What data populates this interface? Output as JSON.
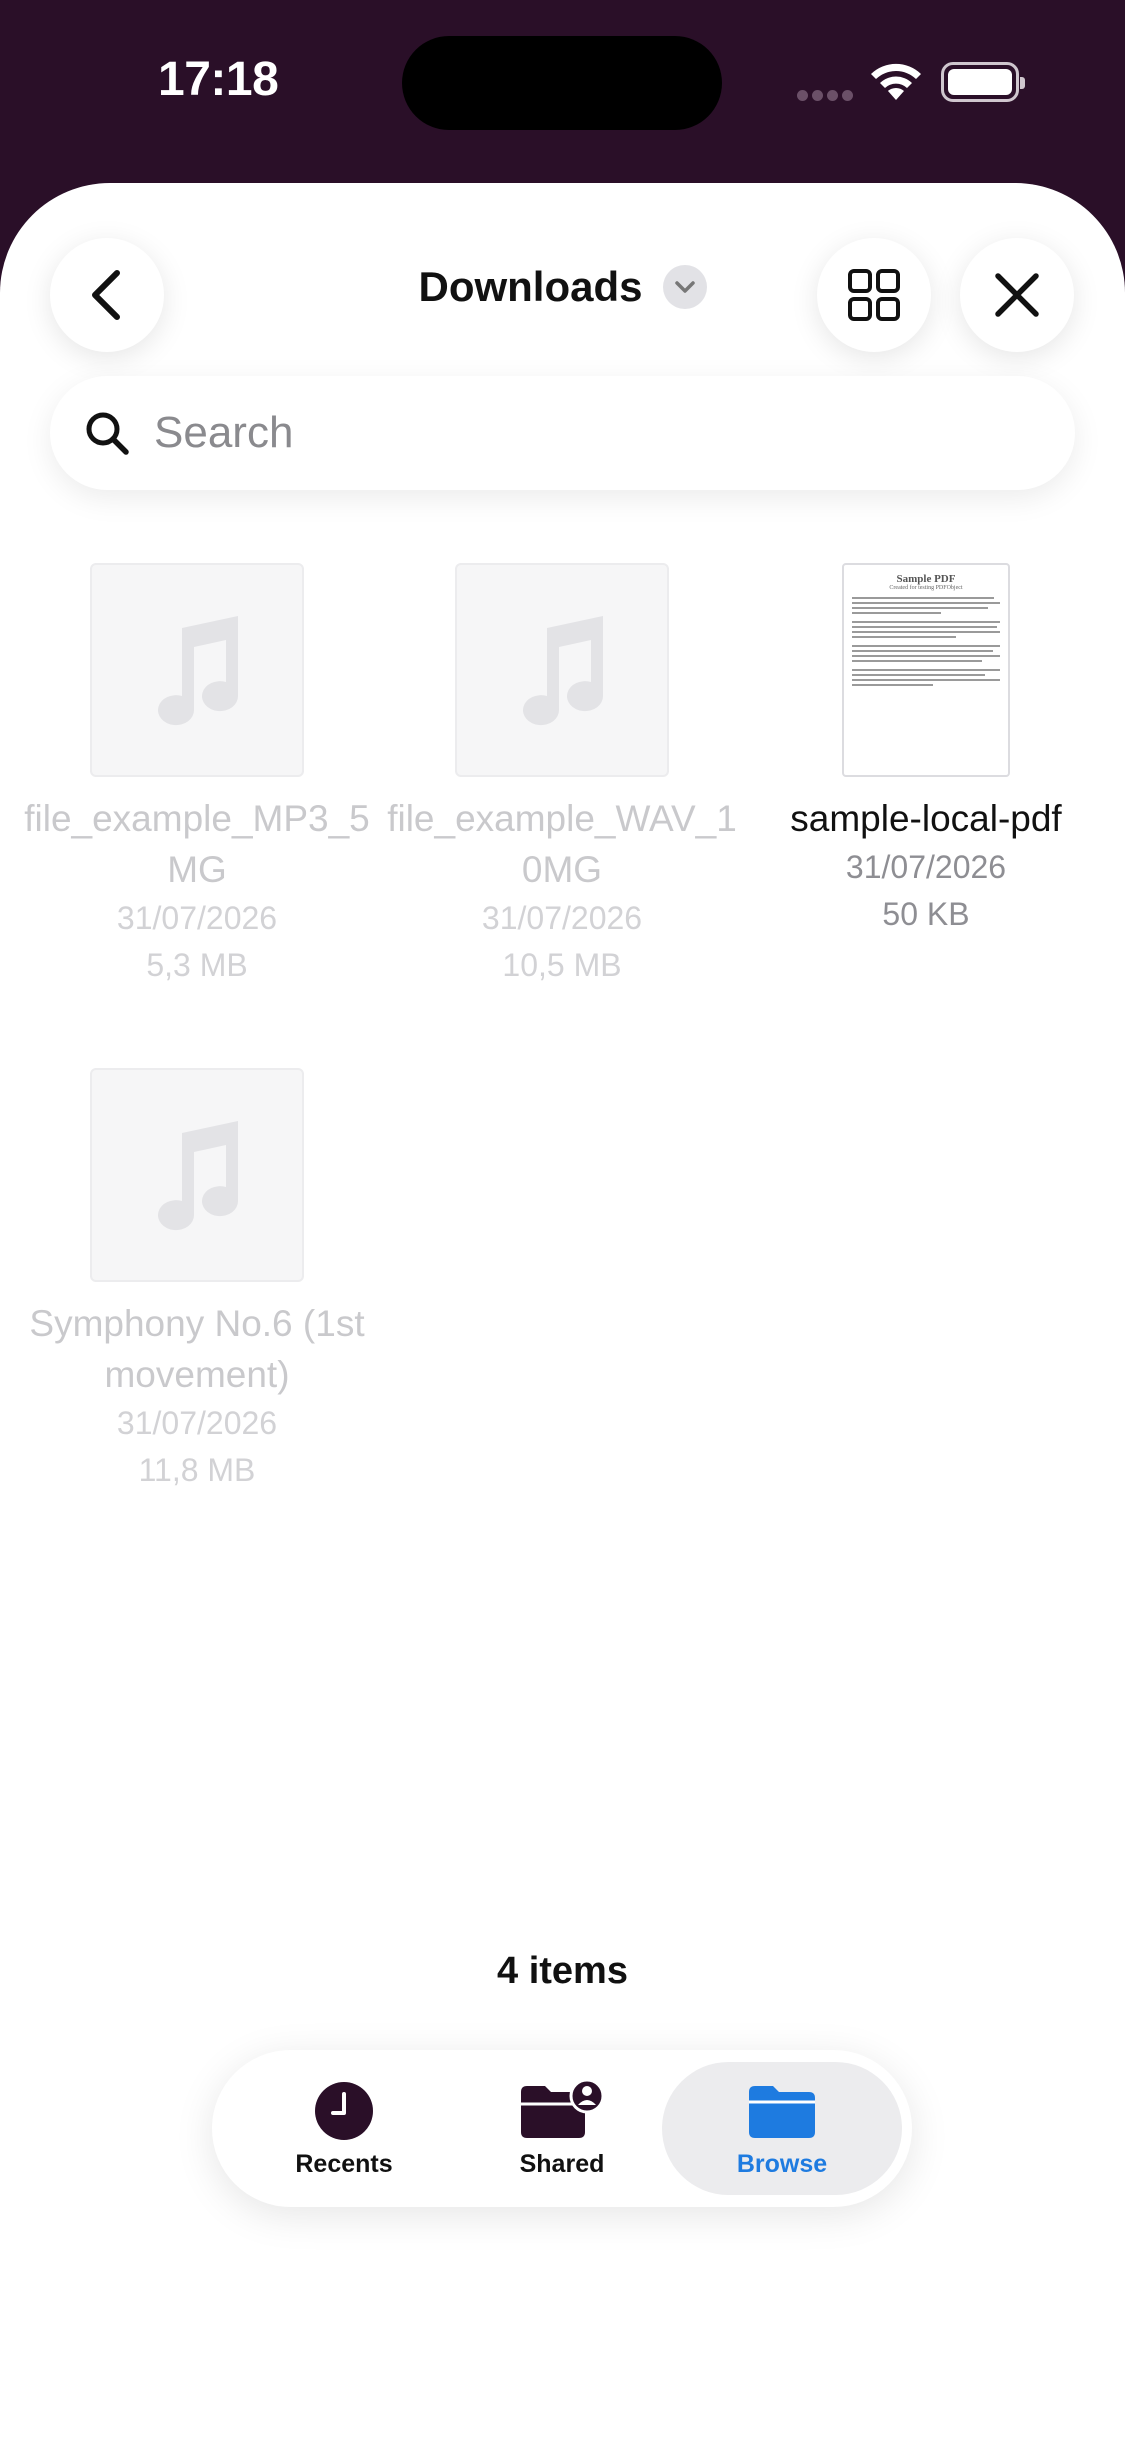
{
  "status_bar": {
    "time": "17:18"
  },
  "header": {
    "title": "Downloads"
  },
  "search": {
    "placeholder": "Search",
    "value": ""
  },
  "files": [
    {
      "name": "file_example_MP3_5MG",
      "date": "31/07/2026",
      "size": "5,3 MB",
      "icon": "music-note-icon",
      "dimmed": true
    },
    {
      "name": "file_example_WAV_10MG",
      "date": "31/07/2026",
      "size": "10,5 MB",
      "icon": "music-note-icon",
      "dimmed": true
    },
    {
      "name": "sample-local-pdf",
      "date": "31/07/2026",
      "size": "50 KB",
      "icon": "pdf-thumbnail",
      "dimmed": false,
      "thumb_title": "Sample PDF",
      "thumb_subtitle": "Created for testing PDFObject"
    },
    {
      "name": "Symphony No.6 (1st movement)",
      "date": "31/07/2026",
      "size": "11,8 MB",
      "icon": "music-note-icon",
      "dimmed": true
    }
  ],
  "footer": {
    "item_count": "4 items"
  },
  "tabs": [
    {
      "label": "Recents",
      "icon": "clock-icon",
      "selected": false
    },
    {
      "label": "Shared",
      "icon": "shared-folder-icon",
      "selected": false
    },
    {
      "label": "Browse",
      "icon": "folder-icon",
      "selected": true
    }
  ],
  "colors": {
    "status_bg": "#2a0f28",
    "accent": "#1e7be0",
    "dim_text": "#c9c9cc"
  }
}
